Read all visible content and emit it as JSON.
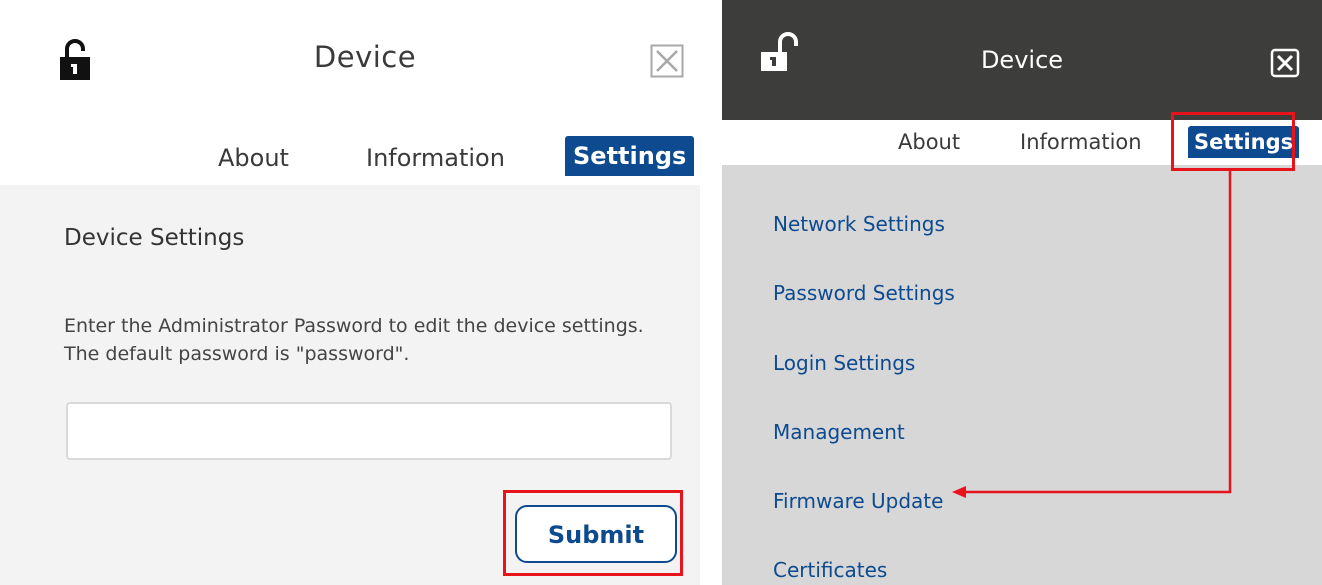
{
  "left": {
    "window_title": "Device",
    "tabs": {
      "about": "About",
      "information": "Information",
      "settings": "Settings"
    },
    "section_title": "Device Settings",
    "description_line1": "Enter the Administrator Password to edit the device settings.",
    "description_line2": "The default password is \"password\".",
    "password_value": "",
    "submit_label": "Submit"
  },
  "right": {
    "window_title": "Device",
    "tabs": {
      "about": "About",
      "information": "Information",
      "settings": "Settings"
    },
    "menu": [
      "Network Settings",
      "Password Settings",
      "Login Settings",
      "Management",
      "Firmware Update",
      "Certificates"
    ]
  },
  "colors": {
    "accent": "#0d4a8f",
    "highlight": "#e8141b",
    "dark_header": "#3d3d3b",
    "body_bg_left": "#f3f3f3",
    "body_bg_right": "#d7d7d7"
  },
  "icons": {
    "lock": "unlocked-padlock-icon",
    "close": "close-x-icon",
    "arrow": "red-callout-arrow"
  }
}
